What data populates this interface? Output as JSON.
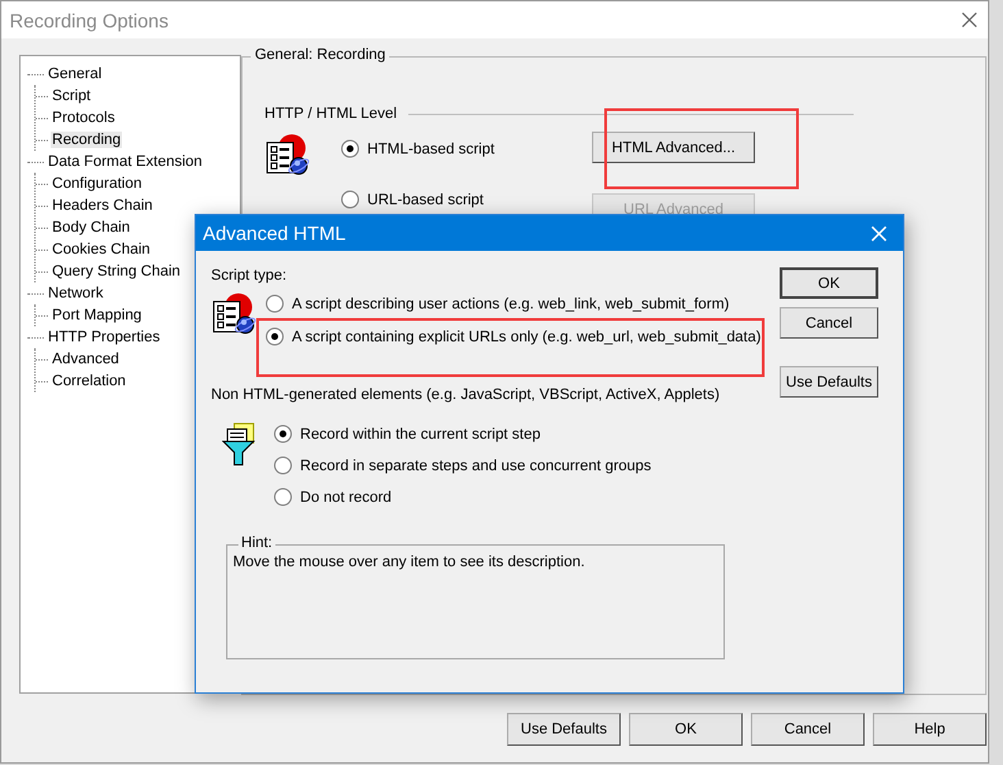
{
  "window": {
    "title": "Recording Options"
  },
  "tree": [
    {
      "label": "General",
      "selected": false,
      "children": [
        {
          "label": "Script",
          "selected": false
        },
        {
          "label": "Protocols",
          "selected": false
        },
        {
          "label": "Recording",
          "selected": true
        }
      ]
    },
    {
      "label": "Data Format Extension",
      "selected": false,
      "children": [
        {
          "label": "Configuration",
          "selected": false
        },
        {
          "label": "Headers Chain",
          "selected": false
        },
        {
          "label": "Body Chain",
          "selected": false
        },
        {
          "label": "Cookies Chain",
          "selected": false
        },
        {
          "label": "Query String Chain",
          "selected": false
        }
      ]
    },
    {
      "label": "Network",
      "selected": false,
      "children": [
        {
          "label": "Port Mapping",
          "selected": false
        }
      ]
    },
    {
      "label": "HTTP Properties",
      "selected": false,
      "children": [
        {
          "label": "Advanced",
          "selected": false
        },
        {
          "label": "Correlation",
          "selected": false
        }
      ]
    }
  ],
  "panel": {
    "title": "General: Recording",
    "section": "HTTP / HTML Level",
    "options": [
      {
        "label": "HTML-based script",
        "selected": true
      },
      {
        "label": "URL-based script",
        "selected": false
      }
    ],
    "buttons": [
      {
        "label": "HTML Advanced...",
        "disabled": false
      },
      {
        "label": "URL Advanced",
        "disabled": true
      }
    ]
  },
  "buttons": [
    "Use Defaults",
    "OK",
    "Cancel",
    "Help"
  ],
  "dialog": {
    "title": "Advanced HTML",
    "script_type_label": "Script type:",
    "script_types": [
      {
        "label": "A script describing user actions (e.g. web_link, web_submit_form)",
        "selected": false
      },
      {
        "label": "A script containing explicit URLs only (e.g. web_url, web_submit_data)",
        "selected": true
      }
    ],
    "non_html_label": "Non HTML-generated elements (e.g. JavaScript, VBScript, ActiveX, Applets)",
    "non_html_options": [
      {
        "label": "Record within the current script step",
        "selected": true
      },
      {
        "label": "Record in separate steps and use concurrent groups",
        "selected": false
      },
      {
        "label": "Do not record",
        "selected": false
      }
    ],
    "hint": {
      "title": "Hint:",
      "text": "Move the mouse over any item to see its description."
    },
    "buttons": [
      "OK",
      "Cancel",
      "Use Defaults"
    ]
  }
}
